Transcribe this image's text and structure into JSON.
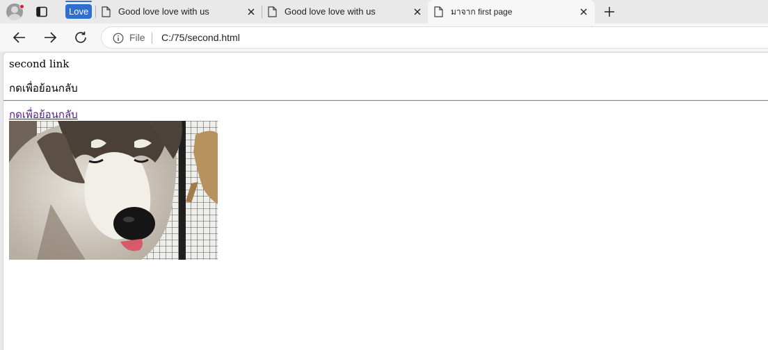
{
  "browser": {
    "tab_group": {
      "label": "Love",
      "color": "#2f6fd4"
    },
    "tabs": [
      {
        "title": "Good love love with us",
        "active": false
      },
      {
        "title": "Good love love with us",
        "active": false
      },
      {
        "title": "มาจาก first page",
        "active": true
      }
    ],
    "address_bar": {
      "scheme_label": "File",
      "url": "C:/75/second.html"
    }
  },
  "page": {
    "text_line": "second link",
    "thai_text": "กดเพื่อย้อนกลับ",
    "back_link": "กดเพื่อย้อนกลับ",
    "image_subject": "husky puppy photo",
    "link_color": "#551a8b"
  }
}
